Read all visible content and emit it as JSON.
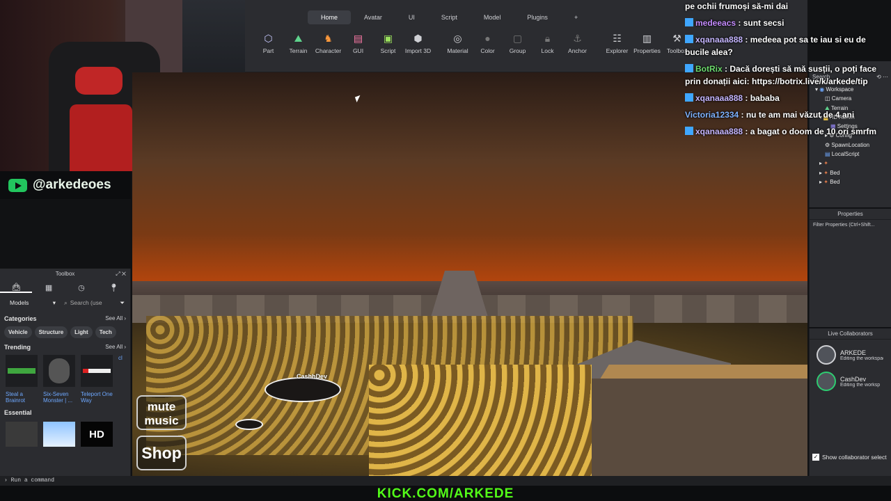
{
  "stream": {
    "youtube_handle": "@arkedeoes",
    "kick_url": "KICK.COM/ARKEDE"
  },
  "ribbon": {
    "tabs": [
      "Home",
      "Avatar",
      "UI",
      "Script",
      "Model",
      "Plugins",
      "+"
    ],
    "active_tab": "Home",
    "tools": [
      {
        "label": "Part",
        "icon": "cube-icon"
      },
      {
        "label": "Terrain",
        "icon": "terrain-icon"
      },
      {
        "label": "Character",
        "icon": "character-icon"
      },
      {
        "label": "GUI",
        "icon": "gui-icon"
      },
      {
        "label": "Script",
        "icon": "script-icon"
      },
      {
        "label": "Import 3D",
        "icon": "import-icon"
      },
      {
        "label": "Material",
        "icon": "material-icon"
      },
      {
        "label": "Color",
        "icon": "color-icon"
      },
      {
        "label": "Group",
        "icon": "group-icon"
      },
      {
        "label": "Lock",
        "icon": "lock-icon"
      },
      {
        "label": "Anchor",
        "icon": "anchor-icon"
      },
      {
        "label": "Explorer",
        "icon": "explorer-icon"
      },
      {
        "label": "Properties",
        "icon": "properties-icon"
      },
      {
        "label": "Toolbox",
        "icon": "toolbox-icon"
      }
    ]
  },
  "viewport": {
    "player_name": "CashhDev",
    "mute_button": "mute music",
    "shop_button": "Shop"
  },
  "toolbox": {
    "title": "Toolbox",
    "category_select": "Models",
    "search_placeholder": "Search (use",
    "categories_heading": "Categories",
    "see_all": "See All",
    "chips": [
      "Vehicle",
      "Structure",
      "Light",
      "Tech"
    ],
    "trending_heading": "Trending",
    "trending": [
      "Steal a Brainrot",
      "Six-Seven Monster | ...",
      "Teleport One Way",
      "cl"
    ],
    "essential_heading": "Essential",
    "essential_hd": "HD"
  },
  "command_bar": {
    "placeholder": "Run a command"
  },
  "explorer": {
    "search": "Search",
    "items": [
      "Workspace",
      "Camera",
      "Terrain",
      "HD Admin",
      "Settings",
      "Config",
      "SpawnLocation",
      "LocalScript",
      "Bed",
      "Bed"
    ]
  },
  "properties": {
    "title": "Properties",
    "filter": "Filter Properties (Ctrl+Shift..."
  },
  "collaborators": {
    "title": "Live Collaborators",
    "users": [
      {
        "name": "ARKEDE",
        "status": "Editing the workspace"
      },
      {
        "name": "CashDev",
        "status": "Editing the worksp"
      }
    ],
    "show_label": "Show collaborator select"
  },
  "chat": {
    "messages": [
      {
        "user": "",
        "text": "pe ochii frumoși să-mi dai"
      },
      {
        "user": "medeeacs",
        "text": " : sunt secsi"
      },
      {
        "user": "xqanaaa888",
        "text": " : medeea pot sa te iau si eu de bucile alea?"
      },
      {
        "user": "BotRix",
        "text": " : Dacă dorești să mă susții, o poți face prin donații aici: https://botrix.live/k/arkede/tip"
      },
      {
        "user": "xqanaaa888",
        "text": " : bababa"
      },
      {
        "user": "Victoria12334",
        "text": " : nu te am mai văzut de 4 ani"
      },
      {
        "user": "xqanaaa888",
        "text": " : a bagat o doom de 10 ori smrfm"
      }
    ]
  }
}
